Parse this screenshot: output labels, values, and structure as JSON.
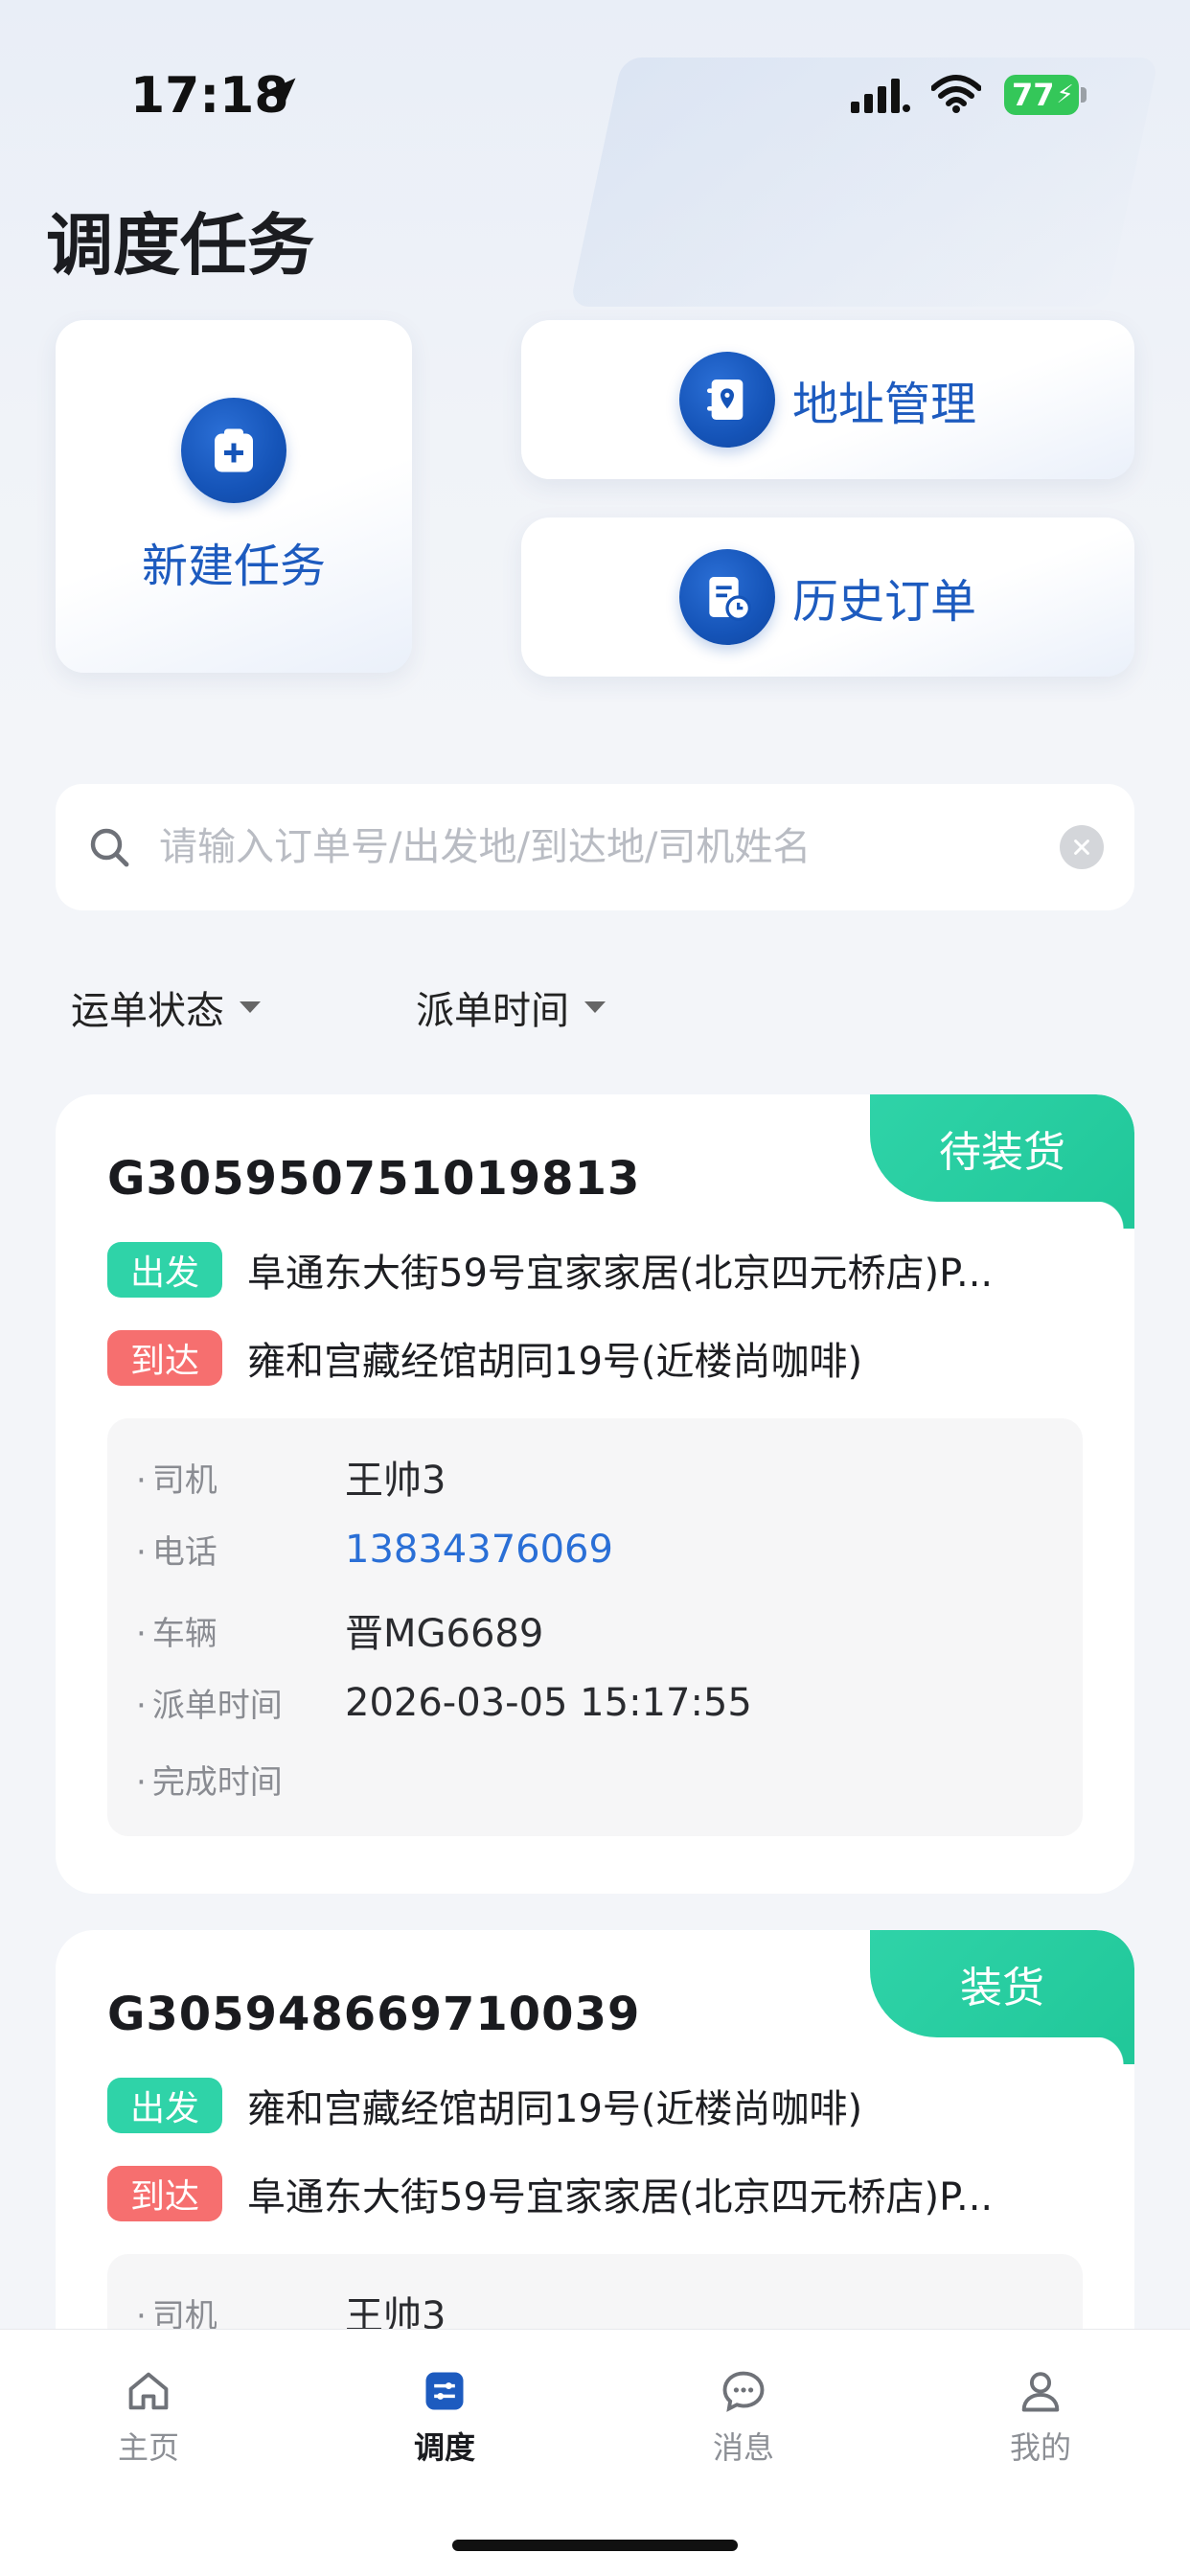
{
  "status_bar": {
    "time": "17:18",
    "battery": "77"
  },
  "header": {
    "title": "调度任务"
  },
  "actions": {
    "new_task": "新建任务",
    "address_management": "地址管理",
    "history_orders": "历史订单"
  },
  "search": {
    "placeholder": "请输入订单号/出发地/到达地/司机姓名",
    "value": ""
  },
  "filters": {
    "status": "运单状态",
    "dispatch_time": "派单时间"
  },
  "labels": {
    "from": "出发",
    "to": "到达",
    "driver": "司机",
    "phone": "电话",
    "vehicle": "车辆",
    "dispatch_time": "派单时间",
    "finish_time": "完成时间"
  },
  "orders": [
    {
      "id": "G305950751019813",
      "status": "待装货",
      "from": "阜通东大街59号宜家家居(北京四元桥店)P...",
      "to": "雍和宫藏经馆胡同19号(近楼尚咖啡)",
      "driver": "王帅3",
      "phone": "13834376069",
      "vehicle": "晋MG6689",
      "dispatch_time": "2026-03-05 15:17:55",
      "finish_time": ""
    },
    {
      "id": "G305948669710039",
      "status": "装货",
      "from": "雍和宫藏经馆胡同19号(近楼尚咖啡)",
      "to": "阜通东大街59号宜家家居(北京四元桥店)P...",
      "driver": "王帅3"
    }
  ],
  "tabbar": {
    "home": "主页",
    "dispatch": "调度",
    "messages": "消息",
    "mine": "我的"
  },
  "colors": {
    "brand_blue": "#1554b8",
    "status_green": "#21c89a",
    "arrive_red": "#f66f6f",
    "phone_blue": "#2a6fd6"
  }
}
